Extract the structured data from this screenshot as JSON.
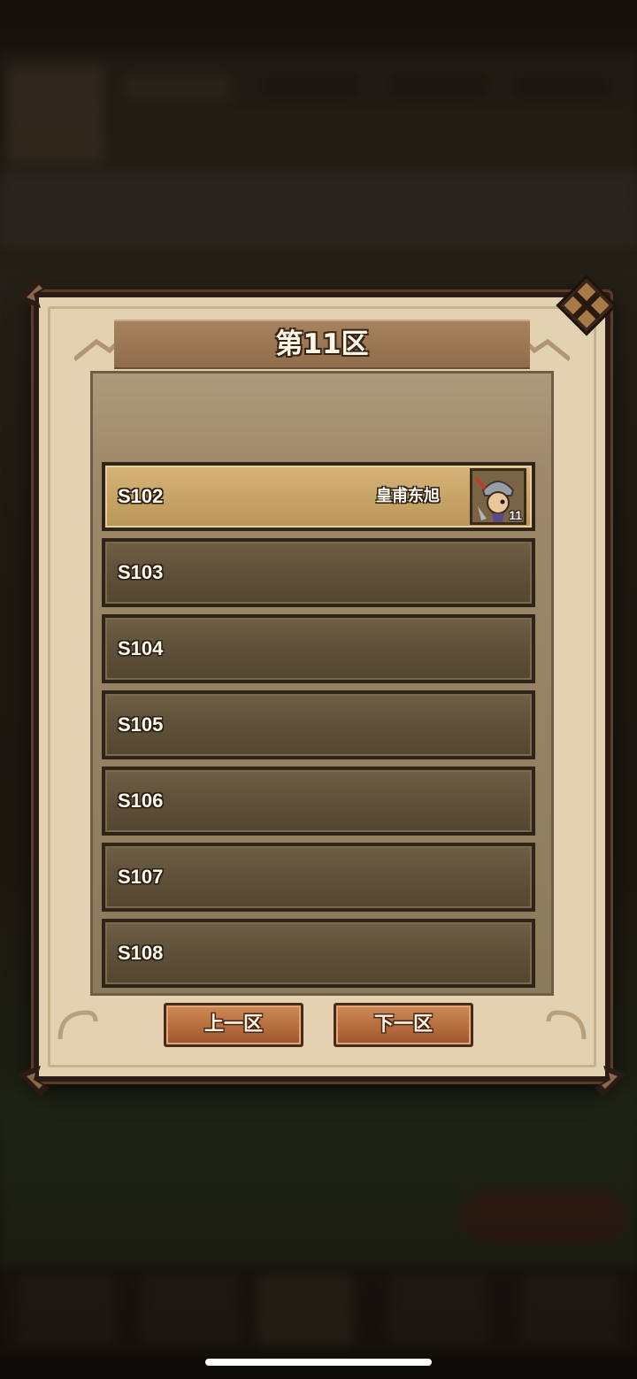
{
  "dialog": {
    "title": "第11区",
    "prev_label": "上一区",
    "next_label": "下一区"
  },
  "servers": [
    {
      "label": "S102",
      "player": "皇甫东旭",
      "level": "11",
      "selected": true
    },
    {
      "label": "S103"
    },
    {
      "label": "S104"
    },
    {
      "label": "S105"
    },
    {
      "label": "S106"
    },
    {
      "label": "S107"
    },
    {
      "label": "S108"
    }
  ],
  "colors": {
    "selected_row": "#c8a566",
    "row": "#5e5039",
    "button": "#b46d3e",
    "frame": "#e2d2b1"
  }
}
